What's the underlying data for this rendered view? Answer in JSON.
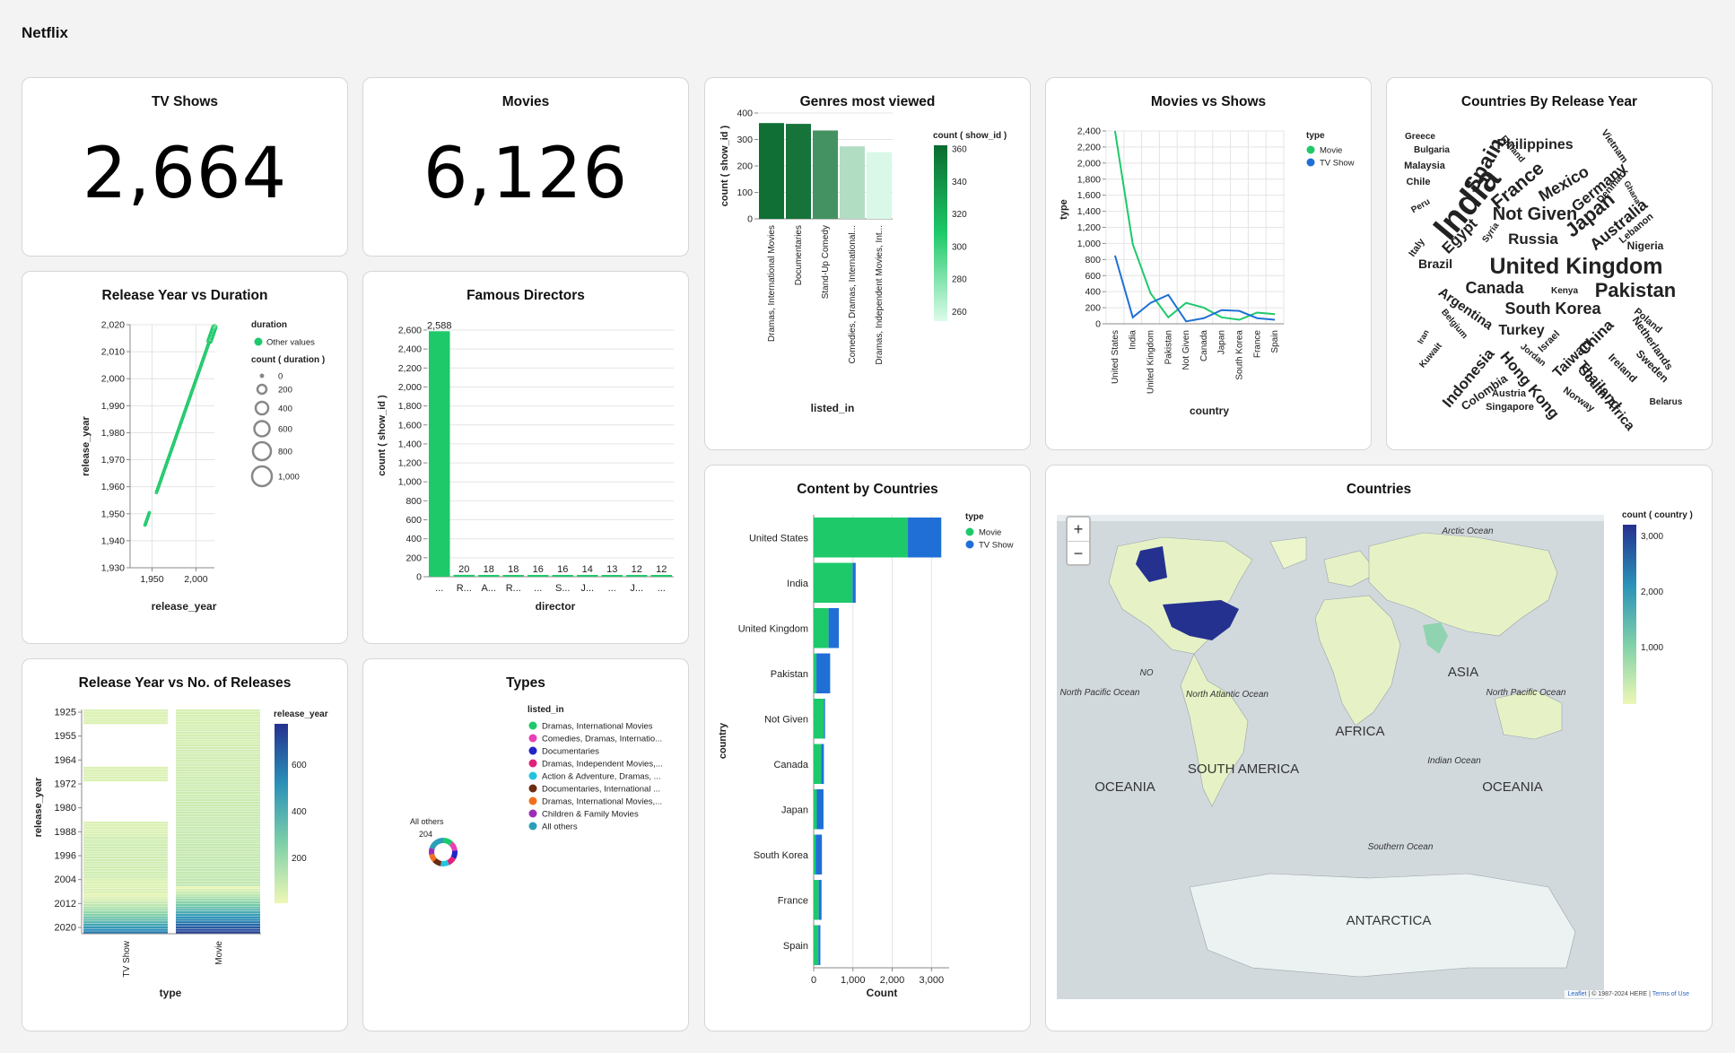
{
  "app_title": "Netflix",
  "kpi": {
    "tv": {
      "title": "TV Shows",
      "value": "2,664"
    },
    "movies": {
      "title": "Movies",
      "value": "6,126"
    }
  },
  "genres": {
    "title": "Genres most viewed",
    "chart_data": {
      "type": "bar",
      "categories": [
        "Dramas, International Movies",
        "Documentaries",
        "Stand-Up Comedy",
        "Comedies, Dramas, International...",
        "Dramas, Independent Movies, Int..."
      ],
      "values": [
        362,
        359,
        334,
        274,
        252
      ],
      "xlabel": "listed_in",
      "ylabel": "count ( show_id )",
      "ylim": [
        0,
        400
      ],
      "yticks": [
        "0",
        "100",
        "200",
        "300",
        "400"
      ],
      "legend_title": "count ( show_id )",
      "legend_ticks": [
        "360",
        "340",
        "320",
        "300",
        "280",
        "260"
      ]
    }
  },
  "movies_vs_shows": {
    "title": "Movies vs Shows",
    "chart_data": {
      "type": "line",
      "categories": [
        "United States",
        "India",
        "United Kingdom",
        "Pakistan",
        "Not Given",
        "Canada",
        "Japan",
        "South Korea",
        "France",
        "Spain"
      ],
      "series": [
        {
          "name": "Movie",
          "color": "#1ec96a",
          "values": [
            2400,
            990,
            380,
            80,
            260,
            200,
            80,
            50,
            140,
            120
          ]
        },
        {
          "name": "TV Show",
          "color": "#1f6fd6",
          "values": [
            850,
            80,
            260,
            360,
            30,
            70,
            170,
            160,
            70,
            50
          ]
        }
      ],
      "xlabel": "country",
      "ylabel": "type",
      "ylim": [
        0,
        2400
      ],
      "yticks": [
        "0",
        "200",
        "400",
        "600",
        "800",
        "1,000",
        "1,200",
        "1,400",
        "1,600",
        "1,800",
        "2,000",
        "2,200",
        "2,400"
      ],
      "legend_title": "type"
    }
  },
  "wordcloud": {
    "title": "Countries By Release Year",
    "words": [
      "Greece",
      "Bulgaria",
      "Malaysia",
      "Chile",
      "Peru",
      "Italy",
      "Spain",
      "Finland",
      "Philippines",
      "Vietnam",
      "France",
      "Mexico",
      "Germany",
      "Denmark",
      "Ghana",
      "India",
      "Egypt",
      "Syria",
      "Not Given",
      "Japan",
      "Australia",
      "Lebanon",
      "Nigeria",
      "Russia",
      "Brazil",
      "United Kingdom",
      "Canada",
      "Kenya",
      "Pakistan",
      "Argentina",
      "South Korea",
      "Belgium",
      "Iran",
      "Turkey",
      "Israel",
      "Poland",
      "Kuwait",
      "China",
      "Netherlands",
      "Jordan",
      "Taiwan",
      "Indonesia",
      "Ireland",
      "Sweden",
      "Hong Kong",
      "Colombia",
      "Thailand",
      "Austria",
      "South Africa",
      "Norway",
      "Singapore",
      "Belarus"
    ]
  },
  "release_duration": {
    "title": "Release Year vs Duration",
    "chart_data": {
      "type": "scatter",
      "xlabel": "release_year",
      "ylabel": "release_year",
      "xticks": [
        "1,950",
        "2,000"
      ],
      "yticks": [
        "1,930",
        "1,940",
        "1,950",
        "1,960",
        "1,970",
        "1,980",
        "1,990",
        "2,000",
        "2,010",
        "2,020"
      ],
      "xlim": [
        1925,
        2021
      ],
      "ylim": [
        1925,
        2022
      ],
      "legend_duration_title": "duration",
      "legend_duration_item": "Other values",
      "legend_size_title": "count ( duration )",
      "legend_size_items": [
        "0",
        "200",
        "400",
        "600",
        "800",
        "1,000"
      ]
    }
  },
  "directors": {
    "title": "Famous Directors",
    "chart_data": {
      "type": "bar",
      "categories": [
        "...",
        "R...",
        "A...",
        "R...",
        "...",
        "S...",
        "J...",
        "...",
        "J...",
        "..."
      ],
      "values": [
        2588,
        20,
        18,
        18,
        16,
        16,
        14,
        13,
        12,
        12
      ],
      "labels": [
        "2,588",
        "20",
        "18",
        "18",
        "16",
        "16",
        "14",
        "13",
        "12",
        "12"
      ],
      "xlabel": "director",
      "ylabel": "count ( show_id )",
      "ylim": [
        0,
        2600
      ],
      "yticks": [
        "0",
        "200",
        "400",
        "600",
        "800",
        "1,000",
        "1,200",
        "1,400",
        "1,600",
        "1,800",
        "2,000",
        "2,200",
        "2,400",
        "2,600"
      ]
    }
  },
  "releases": {
    "title": "Release Year vs No. of Releases",
    "chart_data": {
      "type": "heatmap",
      "categories": [
        "TV Show",
        "Movie"
      ],
      "xlabel": "type",
      "ylabel": "release_year",
      "yticks": [
        "1925",
        "1955",
        "1964",
        "1972",
        "1980",
        "1988",
        "1996",
        "2004",
        "2012",
        "2020"
      ],
      "legend_title": "release_year",
      "legend_ticks": [
        "600",
        "400",
        "200"
      ]
    }
  },
  "types": {
    "title": "Types",
    "legend_title": "listed_in",
    "items": [
      {
        "label": "Dramas, International Movies",
        "color": "#1ec96a"
      },
      {
        "label": "Comedies, Dramas, Internatio...",
        "color": "#e83fb8"
      },
      {
        "label": "Documentaries",
        "color": "#2323c8"
      },
      {
        "label": "Dramas, Independent Movies,...",
        "color": "#e0227a"
      },
      {
        "label": "Action & Adventure, Dramas, ...",
        "color": "#22c4e0"
      },
      {
        "label": "Documentaries, International ...",
        "color": "#6b2c12"
      },
      {
        "label": "Dramas, International Movies,...",
        "color": "#f07020"
      },
      {
        "label": "Children & Family Movies",
        "color": "#9c2fb8"
      },
      {
        "label": "All others",
        "color": "#2aa0b8"
      }
    ],
    "others_label": "All others",
    "others_value": "204"
  },
  "content_countries": {
    "title": "Content by Countries",
    "chart_data": {
      "type": "bar",
      "categories": [
        "United States",
        "India",
        "United Kingdom",
        "Pakistan",
        "Not Given",
        "Canada",
        "Japan",
        "South Korea",
        "France",
        "Spain"
      ],
      "series": [
        {
          "name": "Movie",
          "color": "#1ec96a",
          "values": [
            2400,
            990,
            380,
            70,
            260,
            190,
            80,
            50,
            130,
            120
          ]
        },
        {
          "name": "TV Show",
          "color": "#1f6fd6",
          "values": [
            850,
            80,
            260,
            350,
            30,
            70,
            170,
            160,
            70,
            50
          ]
        }
      ],
      "xlabel": "Count",
      "ylabel": "country",
      "xlim": [
        0,
        3450
      ],
      "xticks": [
        "0",
        "1,000",
        "2,000",
        "3,000"
      ],
      "legend_title": "type"
    }
  },
  "countries_map": {
    "title": "Countries",
    "zoom_in": "+",
    "zoom_out": "−",
    "legend_title": "count ( country )",
    "legend_ticks": [
      "3,000",
      "2,000",
      "1,000"
    ],
    "labels": [
      "Arctic Ocean",
      "North Pacific Ocean",
      "North Atlantic Ocean",
      "North Pacific Ocean",
      "Indian Ocean",
      "Southern Ocean",
      "ANTARCTICA",
      "AFRICA",
      "SOUTH AMERICA",
      "OCEANIA",
      "OCEANIA",
      "ASIA",
      "NO"
    ],
    "attribution_link": "Leaflet",
    "attribution_text": "| © 1987-2024 HERE |",
    "attribution_terms": "Terms of Use"
  }
}
